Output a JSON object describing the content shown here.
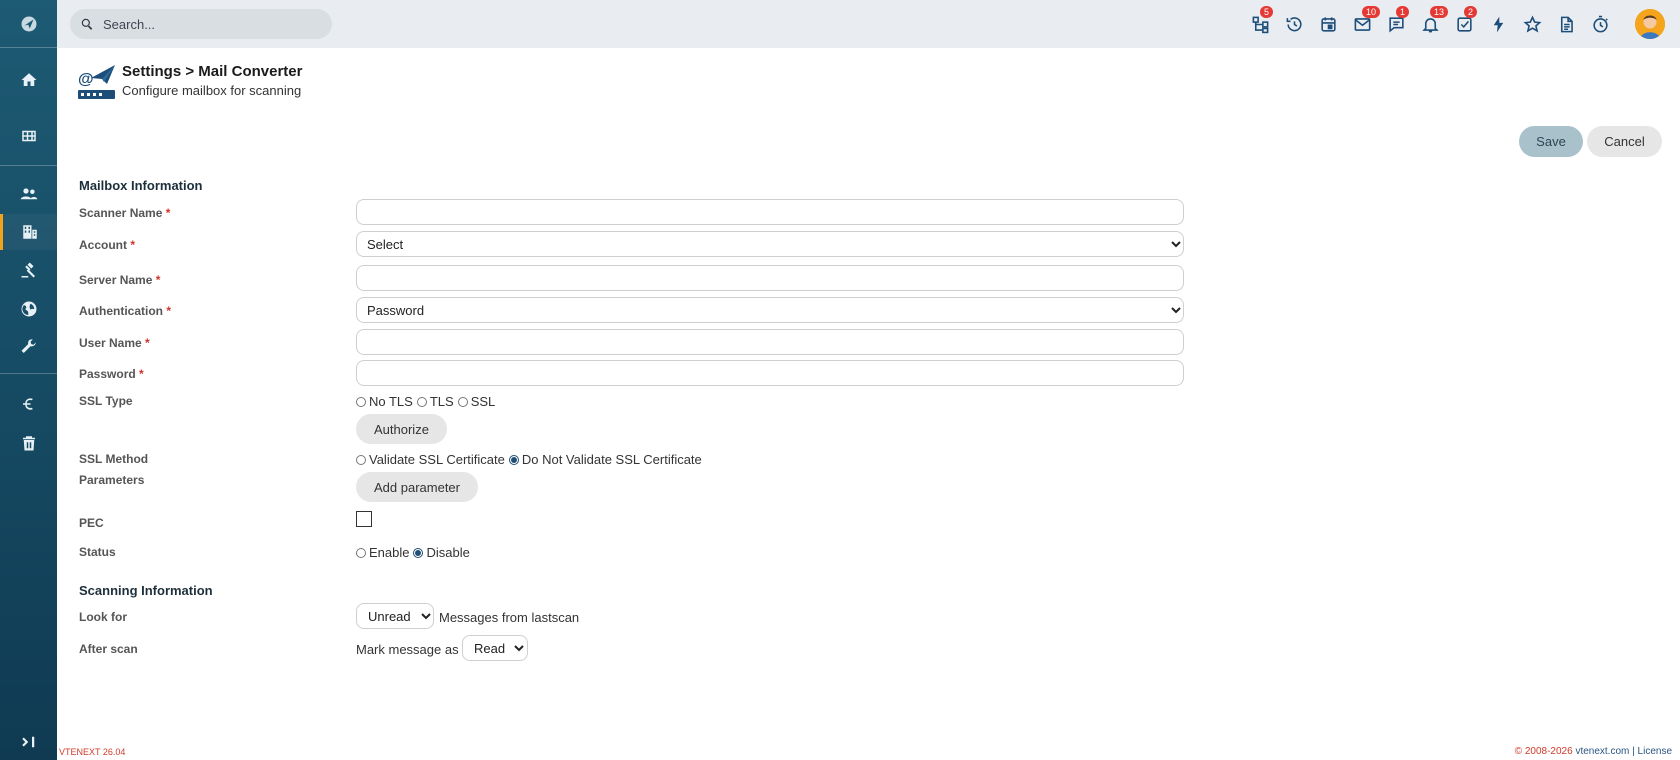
{
  "sidebar": {
    "items": [
      {
        "name": "home-icon"
      },
      {
        "name": "grid-icon"
      },
      {
        "name": "users-icon"
      },
      {
        "name": "building-icon"
      },
      {
        "name": "gavel-icon"
      },
      {
        "name": "globe-icon"
      },
      {
        "name": "wrench-icon"
      },
      {
        "name": "euro-icon"
      },
      {
        "name": "trash-icon"
      },
      {
        "name": "expand-icon"
      }
    ],
    "active_index": 3,
    "accent": "#f2a21b"
  },
  "topbar": {
    "search_placeholder": "Search...",
    "icons": [
      {
        "name": "hierarchy-icon",
        "badge": "5"
      },
      {
        "name": "history-icon",
        "badge": ""
      },
      {
        "name": "calendar-icon",
        "badge": ""
      },
      {
        "name": "mail-icon",
        "badge": "10"
      },
      {
        "name": "chat-icon",
        "badge": "1"
      },
      {
        "name": "bell-icon",
        "badge": "13"
      },
      {
        "name": "tasks-icon",
        "badge": "2"
      },
      {
        "name": "lightning-icon",
        "badge": ""
      },
      {
        "name": "star-icon",
        "badge": ""
      },
      {
        "name": "document-icon",
        "badge": ""
      },
      {
        "name": "timer-icon",
        "badge": ""
      }
    ],
    "badge_color": "#e53935"
  },
  "header": {
    "title": "Settings > Mail Converter",
    "subtitle": "Configure mailbox for scanning"
  },
  "actions": {
    "save_label": "Save",
    "cancel_label": "Cancel"
  },
  "mailbox": {
    "section_title": "Mailbox Information",
    "scanner_name_label": "Scanner Name",
    "account_label": "Account",
    "account_value": "Select",
    "server_name_label": "Server Name",
    "authentication_label": "Authentication",
    "authentication_value": "Password",
    "user_name_label": "User Name",
    "password_label": "Password",
    "ssl_type_label": "SSL Type",
    "ssl_type_options": [
      "No TLS",
      "TLS",
      "SSL"
    ],
    "authorize_label": "Authorize",
    "ssl_method_label": "SSL Method",
    "ssl_method_options": [
      "Validate SSL Certificate",
      "Do Not Validate SSL Certificate"
    ],
    "ssl_method_selected": "Do Not Validate SSL Certificate",
    "parameters_label": "Parameters",
    "add_parameter_label": "Add parameter",
    "pec_label": "PEC",
    "status_label": "Status",
    "status_options": [
      "Enable",
      "Disable"
    ],
    "status_selected": "Disable",
    "required_mark": "*"
  },
  "scanning": {
    "section_title": "Scanning Information",
    "look_for_label": "Look for",
    "look_for_value": "Unread",
    "look_for_suffix": "Messages from lastscan",
    "after_scan_label": "After scan",
    "after_scan_prefix": "Mark message as",
    "after_scan_value": "Read"
  },
  "footer": {
    "version": "VTENEXT 26.04",
    "copyright": "© 2008-2026",
    "site": "vtenext.com",
    "separator": "|",
    "license": "License"
  }
}
